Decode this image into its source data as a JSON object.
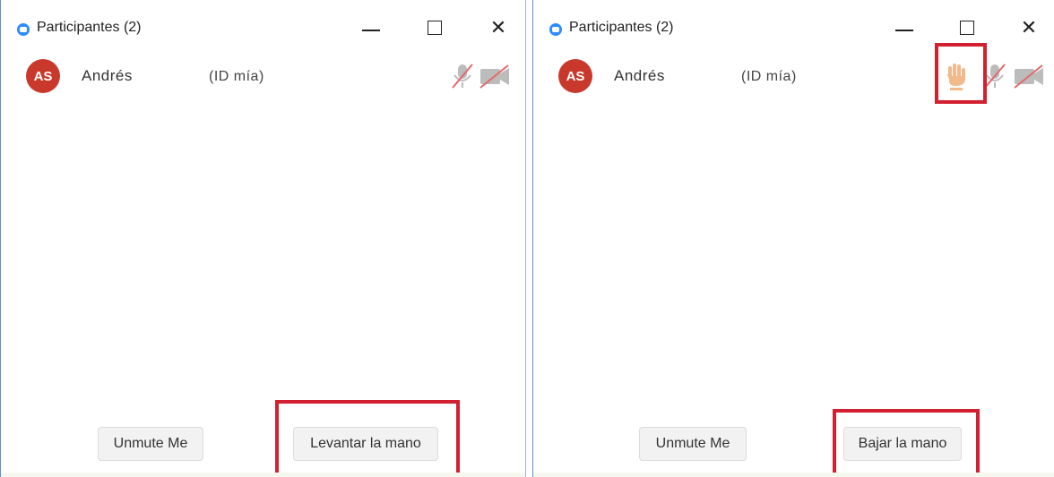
{
  "panels": [
    {
      "title": "Participantes (2)",
      "participant": {
        "initials": "AS",
        "name": "Andrés",
        "tag": "(ID mía)"
      },
      "buttons": {
        "unmute": "Unmute Me",
        "hand": "Levantar la mano"
      }
    },
    {
      "title": "Participantes (2)",
      "participant": {
        "initials": "AS",
        "name": "Andrés",
        "tag": "(ID mía)"
      },
      "buttons": {
        "unmute": "Unmute Me",
        "hand": "Bajar la mano"
      }
    }
  ],
  "colors": {
    "avatar": "#c8392b",
    "highlight": "#d32030",
    "hand": "#f2b98a",
    "muted_icon": "#e26a6a",
    "app_icon": "#2d8cff"
  },
  "icons": [
    "zoom-app-icon",
    "minimize-icon",
    "maximize-icon",
    "close-icon",
    "raised-hand-icon",
    "mic-muted-icon",
    "video-off-icon"
  ]
}
